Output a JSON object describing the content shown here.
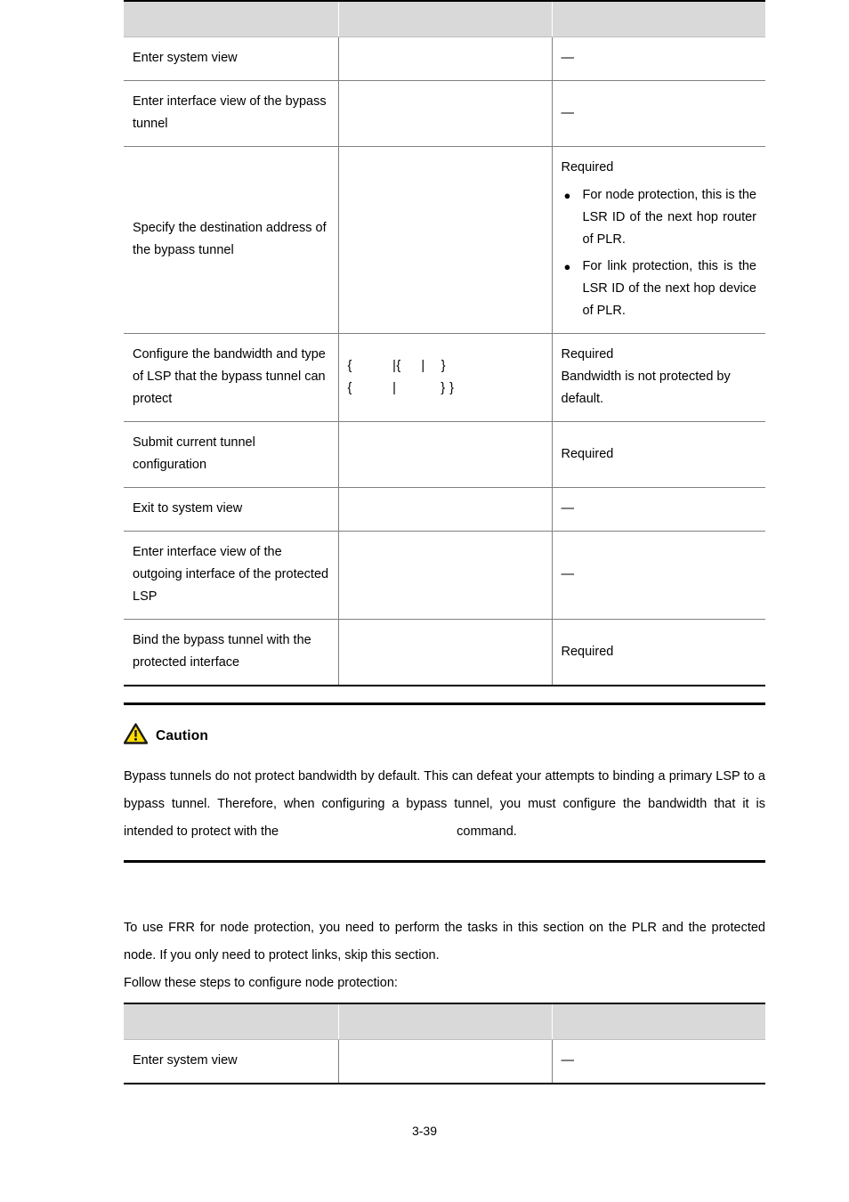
{
  "document": {
    "page_number": "3-39"
  },
  "table1": {
    "headers": [
      "",
      "",
      ""
    ],
    "rows": [
      {
        "step": "Enter system view",
        "command": "",
        "remarks_lead": "—",
        "remarks_notes": []
      },
      {
        "step": "Enter interface view of the bypass tunnel",
        "command": "",
        "remarks_lead": "—",
        "remarks_notes": []
      },
      {
        "step": "Specify the destination address of the bypass tunnel",
        "command": "",
        "remarks_lead": "Required",
        "remarks_notes": [
          "For node protection, this is the LSR ID of the next hop router of PLR.",
          "For link protection, this is the LSR ID of the next hop device of PLR."
        ]
      },
      {
        "step": "Configure the bandwidth and type of LSP that the bypass tunnel can protect",
        "command": "{          |{     |    }\n{          |           } }",
        "remarks_lead": "Required",
        "remarks_notes": [],
        "remarks_extra": "Bandwidth is not protected by default."
      },
      {
        "step": "Submit current tunnel configuration",
        "command": "",
        "remarks_lead": "Required",
        "remarks_notes": []
      },
      {
        "step": "Exit to system view",
        "command": "",
        "remarks_lead": "—",
        "remarks_notes": []
      },
      {
        "step": "Enter interface view of the outgoing interface of the protected LSP",
        "command": "",
        "remarks_lead": "—",
        "remarks_notes": []
      },
      {
        "step": "Bind the bypass tunnel with the protected interface",
        "command": "",
        "remarks_lead": "Required",
        "remarks_notes": []
      }
    ]
  },
  "caution": {
    "icon": "warning-triangle-icon",
    "title": "Caution",
    "icon_color": "#ffdd00",
    "body_part1": "Bypass tunnels do not protect bandwidth by default. This can defeat your attempts to binding a primary LSP to a bypass tunnel. Therefore, when configuring a bypass tunnel, you must configure the bandwidth that it is intended to protect with the",
    "body_part2": "command."
  },
  "section": {
    "heading": "",
    "para1": "To use FRR for node protection, you need to perform the tasks in this section on the PLR and the protected node. If you only need to protect links, skip this section.",
    "para2": "Follow these steps to configure node protection:"
  },
  "table2": {
    "headers": [
      "",
      "",
      ""
    ],
    "rows": [
      {
        "step": "Enter system view",
        "command": "",
        "remarks_lead": "—",
        "remarks_notes": []
      }
    ]
  }
}
